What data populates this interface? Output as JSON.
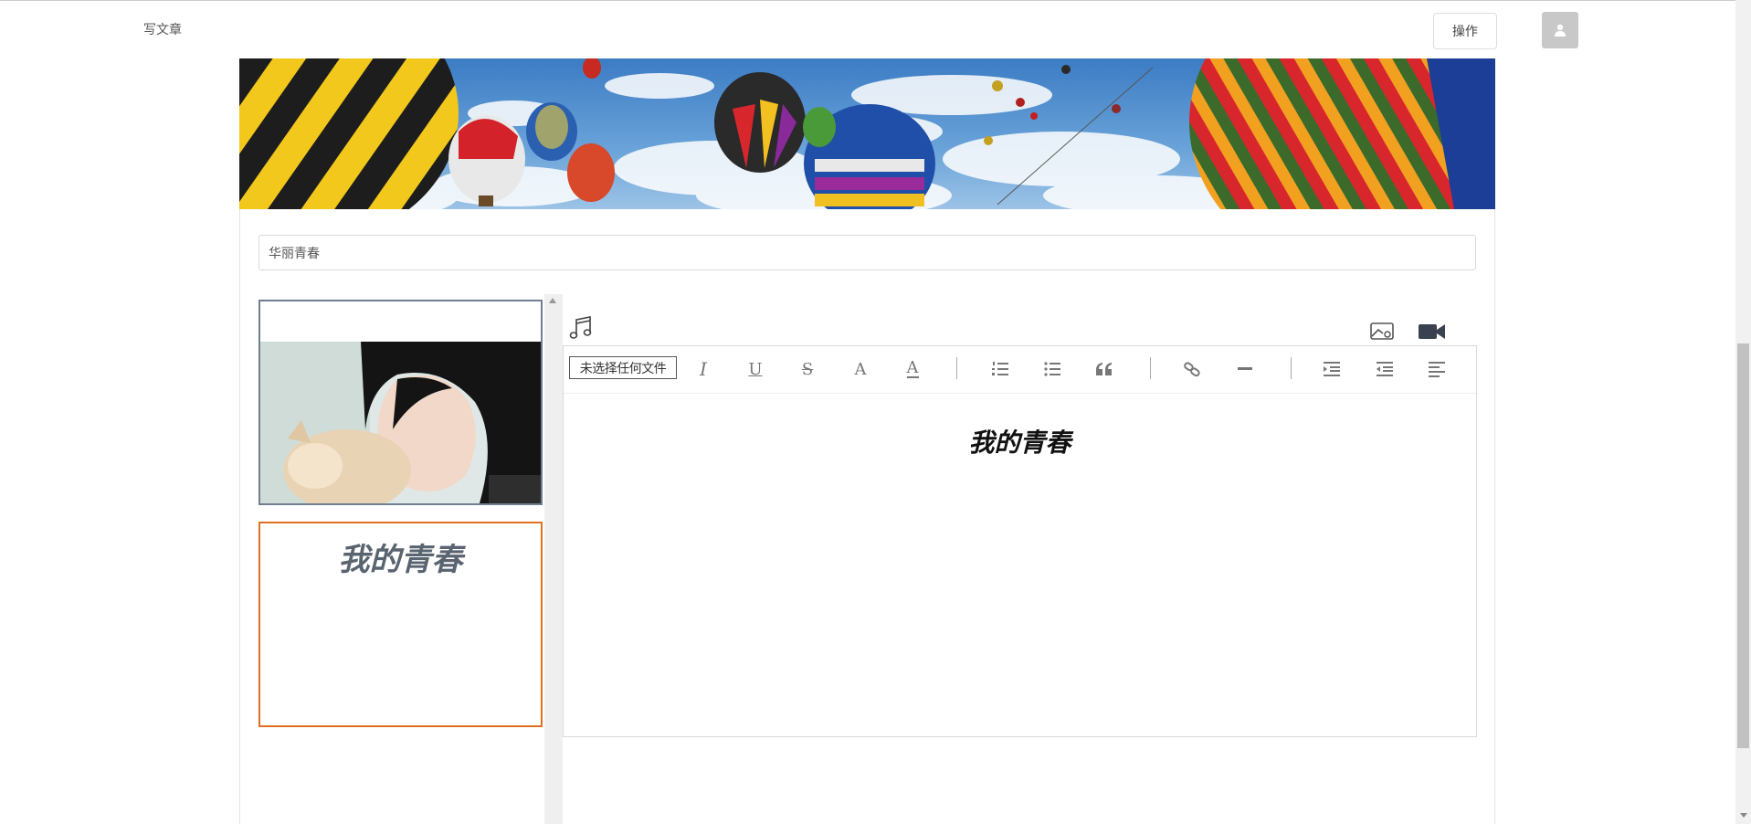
{
  "nav": {
    "title": "写文章",
    "operate_label": "操作",
    "avatar_icon": "user-icon"
  },
  "banner": {
    "description_icon": "hot-air-balloons-banner",
    "sky_color": "#4f8fd0"
  },
  "article": {
    "title_value": "华丽青春",
    "content_heading": "我的青春"
  },
  "sidebar": {
    "cover_icon": "photo-thumbnail",
    "text_card_heading": "我的青春",
    "selected_border_color": "#e07020"
  },
  "media_icons": [
    "music-icon",
    "image-icon",
    "video-icon"
  ],
  "toolbar": {
    "file_input_label": "未选择任何文件",
    "buttons": [
      "italic-icon",
      "underline-icon",
      "strikethrough-icon",
      "font-icon",
      "font-color-icon",
      "ordered-list-icon",
      "unordered-list-icon",
      "quote-icon",
      "link-icon",
      "horizontal-rule-icon",
      "indent-icon",
      "outdent-icon",
      "align-left-icon"
    ]
  }
}
